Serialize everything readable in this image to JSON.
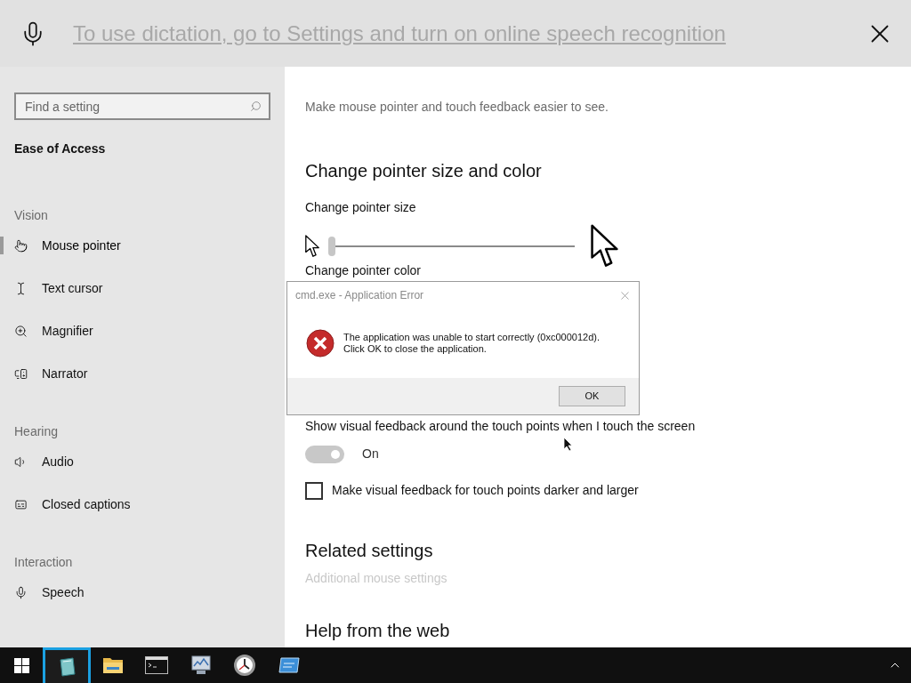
{
  "dictation_bar": {
    "message": "To use dictation, go to Settings and turn on online speech recognition"
  },
  "sidebar": {
    "search": {
      "placeholder": "Find a setting"
    },
    "category": "Ease of Access",
    "groups": [
      {
        "heading": "Vision",
        "items": [
          {
            "label": "Mouse pointer",
            "selected": true
          },
          {
            "label": "Text cursor",
            "selected": false
          },
          {
            "label": "Magnifier",
            "selected": false
          },
          {
            "label": "Narrator",
            "selected": false
          }
        ]
      },
      {
        "heading": "Hearing",
        "items": [
          {
            "label": "Audio",
            "selected": false
          },
          {
            "label": "Closed captions",
            "selected": false
          }
        ]
      },
      {
        "heading": "Interaction",
        "items": [
          {
            "label": "Speech",
            "selected": false
          }
        ]
      }
    ]
  },
  "main": {
    "description": "Make mouse pointer and touch feedback easier to see.",
    "section": "Change pointer size and color",
    "size_label": "Change pointer size",
    "size_slider": {
      "level": 0
    },
    "color_label": "Change pointer color",
    "touch_label": "Show visual feedback around the touch points when I touch the screen",
    "touch_toggle": {
      "on": true,
      "disabled": true,
      "label": "On"
    },
    "checkbox": {
      "label": "Make visual feedback for touch points darker and larger",
      "checked": false
    },
    "related_heading": "Related settings",
    "related_link": {
      "label": "Additional mouse settings",
      "disabled": true
    },
    "help_heading": "Help from the web"
  },
  "dialog": {
    "title": "cmd.exe - Application Error",
    "lines": [
      "The application was unable to start correctly (0xc000012d).",
      "Click OK to close the application."
    ],
    "button": "OK"
  },
  "taskbar": {
    "items": [
      {
        "selected": true
      },
      {
        "selected": false
      },
      {
        "selected": false
      },
      {
        "selected": false
      },
      {
        "selected": false
      },
      {
        "selected": false
      }
    ]
  }
}
